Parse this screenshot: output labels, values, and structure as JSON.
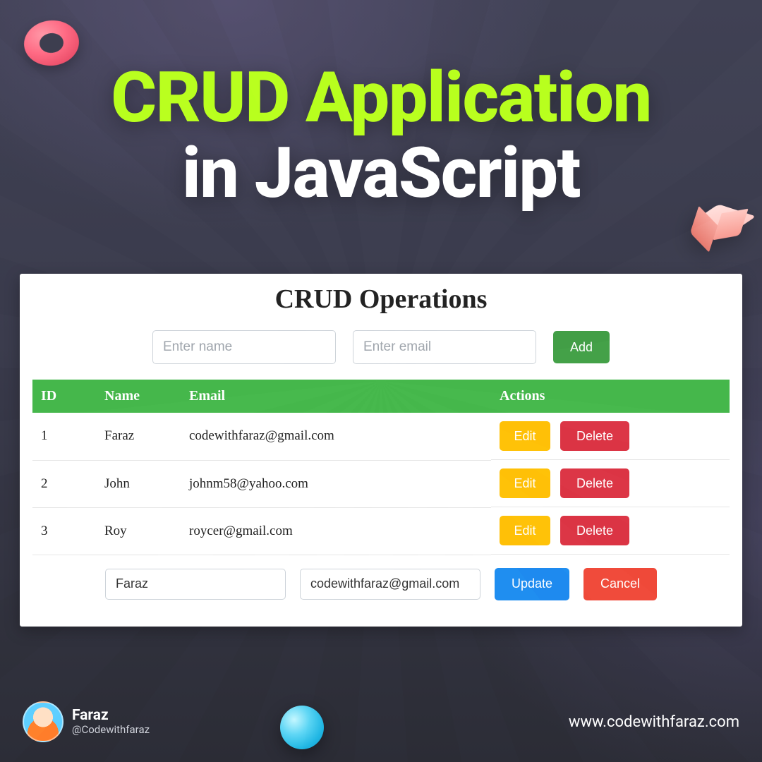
{
  "headline": {
    "line1": "CRUD Application",
    "line2": "in JavaScript"
  },
  "card": {
    "title": "CRUD Operations",
    "inputs": {
      "name_placeholder": "Enter name",
      "email_placeholder": "Enter email"
    },
    "buttons": {
      "add": "Add",
      "edit": "Edit",
      "delete": "Delete",
      "update": "Update",
      "cancel": "Cancel"
    },
    "headers": {
      "id": "ID",
      "name": "Name",
      "email": "Email",
      "actions": "Actions"
    },
    "rows": [
      {
        "id": "1",
        "name": "Faraz",
        "email": "codewithfaraz@gmail.com"
      },
      {
        "id": "2",
        "name": "John",
        "email": "johnm58@yahoo.com"
      },
      {
        "id": "3",
        "name": "Roy",
        "email": "roycer@gmail.com"
      }
    ],
    "editing": {
      "name": "Faraz",
      "email": "codewithfaraz@gmail.com"
    }
  },
  "footer": {
    "name": "Faraz",
    "handle": "@Codewithfaraz",
    "url": "www.codewithfaraz.com"
  },
  "colors": {
    "accent_lime": "#b9ff1e",
    "table_header": "#46b84c",
    "edit_btn": "#ffc107",
    "delete_btn": "#dc3545",
    "update_btn": "#1e8cf0",
    "cancel_btn": "#f04a3a"
  }
}
